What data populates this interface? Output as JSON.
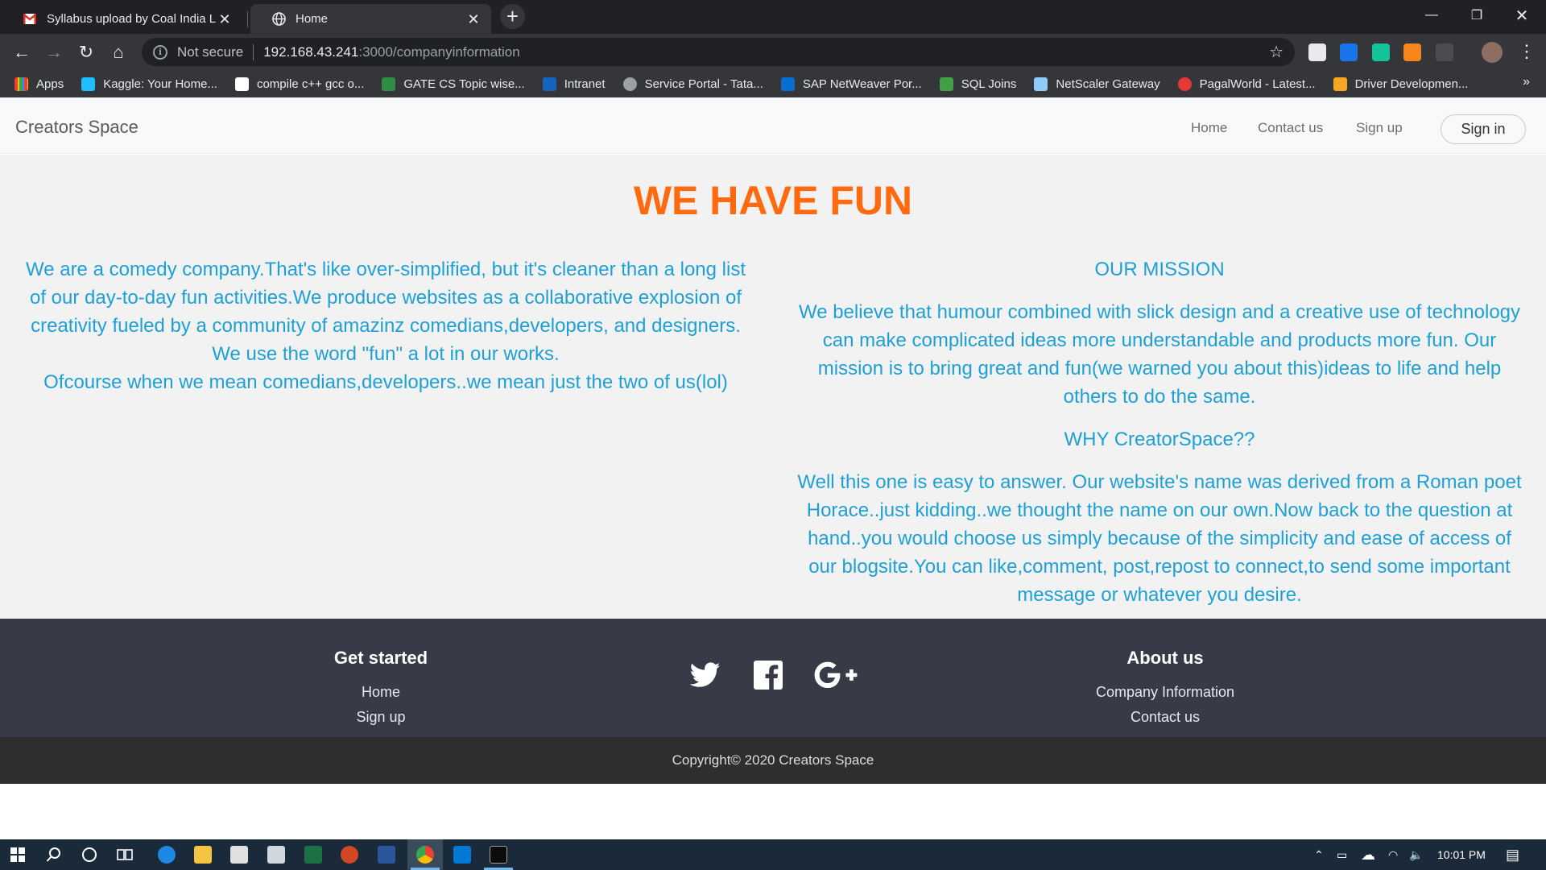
{
  "browser": {
    "tabs": [
      {
        "title": "Syllabus upload by Coal India Lin",
        "active": false
      },
      {
        "title": "Home",
        "active": true
      }
    ],
    "security_label": "Not secure",
    "url_host": "192.168.43.241",
    "url_path": ":3000/companyinformation",
    "bookmarks": [
      {
        "label": "Apps",
        "color": "#ea4335"
      },
      {
        "label": "Kaggle: Your Home...",
        "color": "#20beff"
      },
      {
        "label": "compile c++ gcc o...",
        "color": "#ffffff"
      },
      {
        "label": "GATE CS Topic wise...",
        "color": "#2f8d46"
      },
      {
        "label": "Intranet",
        "color": "#1565c0"
      },
      {
        "label": "Service Portal - Tata...",
        "color": "#9aa0a6"
      },
      {
        "label": "SAP NetWeaver Por...",
        "color": "#0a6ed1"
      },
      {
        "label": "SQL Joins",
        "color": "#43a047"
      },
      {
        "label": "NetScaler Gateway",
        "color": "#90caf9"
      },
      {
        "label": "PagalWorld - Latest...",
        "color": "#e53935"
      },
      {
        "label": "Driver Developmen...",
        "color": "#f5a623"
      }
    ],
    "bookmarks_more": "»"
  },
  "site": {
    "brand": "Creators Space",
    "nav": {
      "home": "Home",
      "contact": "Contact us",
      "signup": "Sign up",
      "signin": "Sign in"
    },
    "headline": "WE HAVE FUN",
    "left_text": "We are a comedy company.That's like over-simplified, but it's cleaner than a long list of our day-to-day fun activities.We produce websites as a collaborative explosion of creativity fueled by a community of amazinz comedians,developers, and designers. We use the word \"fun\" a lot in our works.",
    "left_text2": "Ofcourse when we mean comedians,developers..we mean just the two of us(lol)",
    "mission_title": "OUR MISSION",
    "mission_text": "We believe that humour combined with slick design and a creative use of technology can make complicated ideas more understandable and products more fun. Our mission is to bring great and fun(we warned you about this)ideas to life and help others to do the same.",
    "why_title": "WHY CreatorSpace??",
    "why_text": "Well this one is easy to answer. Our website's name was derived from a Roman poet Horace..just kidding..we thought the name on our own.Now back to the question at hand..you would choose us simply because of the simplicity and ease of access of our blogsite.You can like,comment, post,repost to connect,to send some important message or whatever you desire.",
    "footer": {
      "get_started_title": "Get started",
      "get_started_links": [
        "Home",
        "Sign up"
      ],
      "about_title": "About us",
      "about_links": [
        "Company Information",
        "Contact us"
      ],
      "social_icons": [
        "twitter-icon",
        "facebook-icon",
        "google-plus-icon"
      ]
    },
    "copyright": "Copyright© 2020 Creators Space"
  },
  "taskbar": {
    "clock": "10:01 PM"
  },
  "colors": {
    "headline": "#ff6a10",
    "body_text": "#1ea0d6",
    "footer_bg": "#373a47",
    "copyright_bg": "#2e2e2e"
  }
}
